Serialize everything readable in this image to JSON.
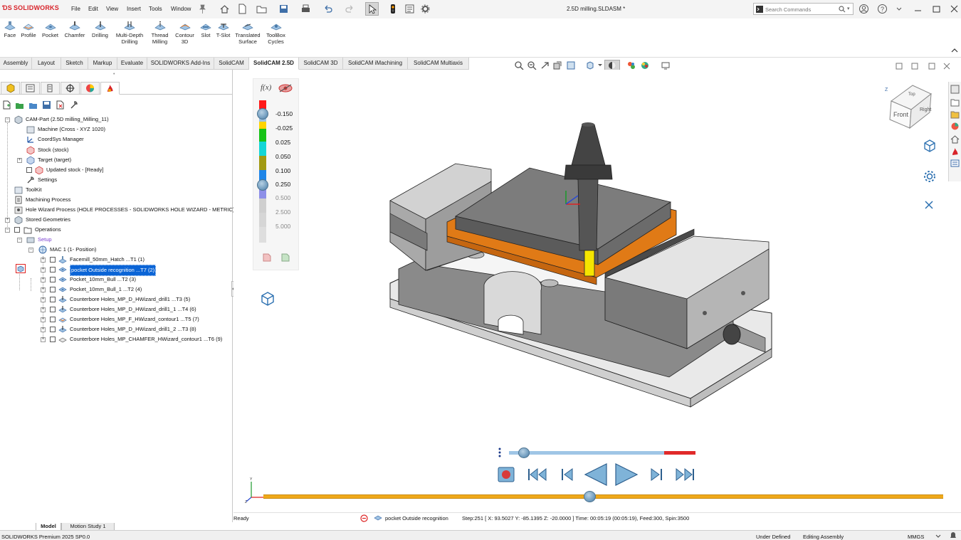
{
  "app": {
    "brand": "SOLIDWORKS",
    "document_title": "2.5D milling.SLDASM *"
  },
  "menu": [
    "File",
    "Edit",
    "View",
    "Insert",
    "Tools",
    "Window"
  ],
  "search": {
    "placeholder": "Search Commands"
  },
  "ribbon": {
    "buttons": [
      {
        "label1": "Face",
        "label2": ""
      },
      {
        "label1": "Profile",
        "label2": ""
      },
      {
        "label1": "Pocket",
        "label2": ""
      },
      {
        "label1": "Chamfer",
        "label2": ""
      },
      {
        "label1": "Drilling",
        "label2": ""
      },
      {
        "label1": "Multi-Depth",
        "label2": "Drilling"
      },
      {
        "label1": "Thread",
        "label2": "Milling"
      },
      {
        "label1": "Contour",
        "label2": "3D"
      },
      {
        "label1": "Slot",
        "label2": ""
      },
      {
        "label1": "T-Slot",
        "label2": ""
      },
      {
        "label1": "Translated",
        "label2": "Surface"
      },
      {
        "label1": "ToolBox",
        "label2": "Cycles"
      }
    ]
  },
  "tabs": [
    "Assembly",
    "Layout",
    "Sketch",
    "Markup",
    "Evaluate",
    "SOLIDWORKS Add-Ins",
    "SolidCAM",
    "SolidCAM 2.5D",
    "SolidCAM 3D",
    "SolidCAM iMachining",
    "SolidCAM Multiaxis"
  ],
  "active_tab": "SolidCAM 2.5D",
  "tree": {
    "root": "CAM-Part (2.5D milling_Milling_11)",
    "machine": "Machine (Cross - XYZ 1020)",
    "coordsys": "CoordSys Manager",
    "stock": "Stock (stock)",
    "target": "Target (target)",
    "updated_stock": "Updated stock - [Ready]",
    "settings": "Settings",
    "toolkit": "ToolKit",
    "machining_process": "Machining Process",
    "hole_wizard": "Hole Wizard Process (HOLE PROCESSES - SOLIDWORKS HOLE WIZARD - METRIC)",
    "stored_geometries": "Stored Geometries",
    "operations": "Operations",
    "setup": "Setup",
    "mac": "MAC 1 (1- Position)",
    "ops": [
      "Facemill_50mm_Hatch ...T1 (1)",
      "pocket Outside recognition ...T7 (2)",
      "Pocket_10mm_Bull ...T2 (3)",
      "Pocket_10mm_Bull_1 ...T2 (4)",
      "Counterbore Holes_MP_D_HWizard_drill1 ...T3 (5)",
      "Counterbore Holes_MP_D_HWizard_drill1_1 ...T4 (6)",
      "Counterbore Holes_MP_F_HWizard_contour1 ...T5 (7)",
      "Counterbore Holes_MP_D_HWizard_drill1_2 ...T3 (8)",
      "Counterbore Holes_MP_CHAMFER_HWizard_contour1 ...T6 (9)"
    ]
  },
  "legend": {
    "values": [
      "-0.150",
      "-0.025",
      "0.025",
      "0.050",
      "0.100",
      "0.250",
      "0.500",
      "2.500",
      "5.000"
    ],
    "colors": [
      "#ff1a1a",
      "#9ec3e0",
      "#ffd400",
      "#17c317",
      "#14d6d6",
      "#a19a12",
      "#1f86e8",
      "#8d8fe8",
      "#cfcfcf",
      "#d6d6d6",
      "#dedede"
    ],
    "fx_label": "f(x)"
  },
  "simulation": {
    "progress_fraction": 0.82,
    "main_progress_fraction": 0.48
  },
  "status": {
    "left": "Ready",
    "operation": "pocket Outside recognition",
    "detail": "Step:251 [ X: 93.5027 Y: -85.1395 Z: -20.0000 ] Time: 00:05:19 (00:05:19), Feed:300, Spin:3500",
    "product": "SOLIDWORKS Premium 2025 SP0.0",
    "under_defined": "Under Defined",
    "editing": "Editing Assembly",
    "units": "MMGS"
  },
  "bottom_tabs": [
    "Model",
    "Motion Study 1"
  ],
  "colors": {
    "accent": "#d8232a",
    "selection": "#0a64d6",
    "sim_track": "#f0a91a",
    "playback_blue": "#3f8ec5"
  }
}
